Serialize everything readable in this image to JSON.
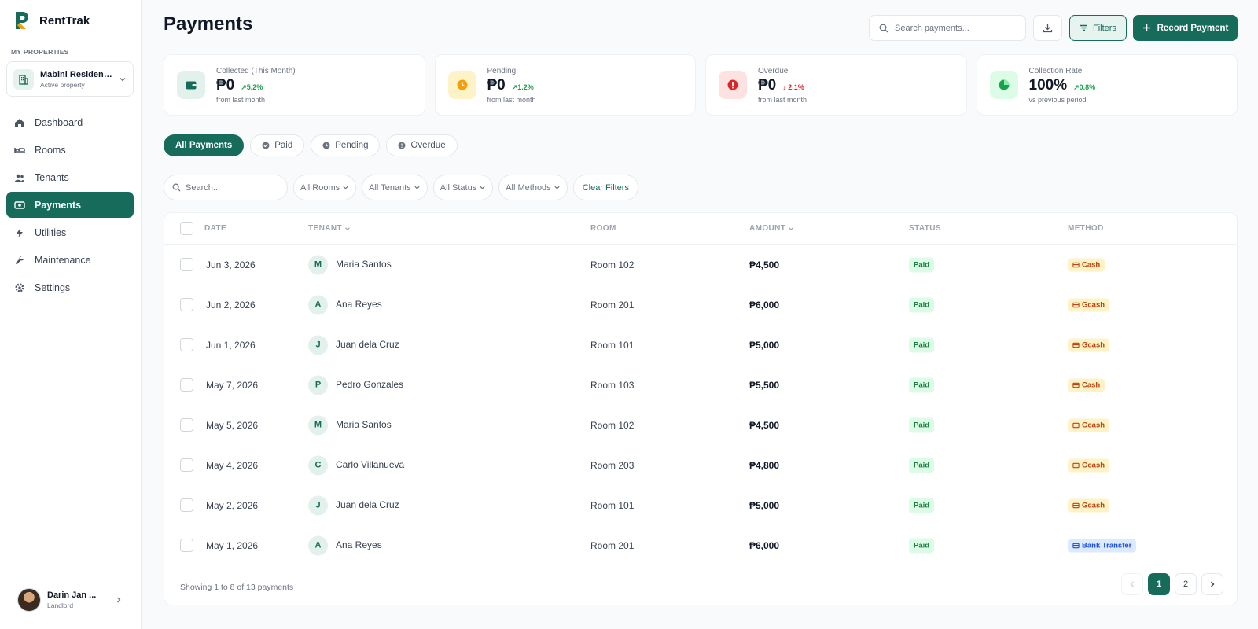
{
  "app": {
    "name": "RentTrak"
  },
  "sidebar": {
    "section_label": "MY PROPERTIES",
    "property": {
      "name": "Mabini Residenc...",
      "status": "Active property"
    },
    "items": [
      {
        "label": "Dashboard",
        "icon": "home-icon"
      },
      {
        "label": "Rooms",
        "icon": "bed-icon"
      },
      {
        "label": "Tenants",
        "icon": "users-icon"
      },
      {
        "label": "Payments",
        "icon": "money-icon",
        "active": true
      },
      {
        "label": "Utilities",
        "icon": "bolt-icon"
      },
      {
        "label": "Maintenance",
        "icon": "wrench-icon"
      },
      {
        "label": "Settings",
        "icon": "gear-icon"
      }
    ],
    "user": {
      "name": "Darin Jan ...",
      "role": "Landlord"
    }
  },
  "header": {
    "title": "Payments",
    "search_placeholder": "Search payments...",
    "filters_label": "Filters",
    "record_label": "Record Payment"
  },
  "stats": [
    {
      "label": "Collected (This Month)",
      "value": "₱0",
      "change": "5.2%",
      "direction": "up",
      "note": "from last month",
      "color": "#16a34a"
    },
    {
      "label": "Pending",
      "value": "₱0",
      "change": "1.2%",
      "direction": "up",
      "note": "from last month",
      "color": "#16a34a"
    },
    {
      "label": "Overdue",
      "value": "₱0",
      "change": "2.1%",
      "direction": "down",
      "note": "from last month",
      "color": "#dc2626"
    },
    {
      "label": "Collection Rate",
      "value": "100%",
      "change": "0.8%",
      "direction": "up",
      "note": "vs previous period",
      "color": "#16a34a"
    }
  ],
  "tabs": [
    {
      "label": "All Payments",
      "active": true
    },
    {
      "label": "Paid"
    },
    {
      "label": "Pending"
    },
    {
      "label": "Overdue"
    }
  ],
  "filters": {
    "search_placeholder": "Search...",
    "rooms": "All Rooms",
    "tenants": "All Tenants",
    "status": "All Status",
    "methods": "All Methods",
    "clear": "Clear Filters"
  },
  "table": {
    "columns": [
      "DATE",
      "TENANT",
      "ROOM",
      "AMOUNT",
      "STATUS",
      "METHOD"
    ],
    "rows": [
      {
        "date": "Jun 3, 2026",
        "initial": "M",
        "tenant": "Maria Santos",
        "room": "Room 102",
        "amount": "₱4,500",
        "status": "Paid",
        "method": "Cash",
        "method_type": "cash"
      },
      {
        "date": "Jun 2, 2026",
        "initial": "A",
        "tenant": "Ana Reyes",
        "room": "Room 201",
        "amount": "₱6,000",
        "status": "Paid",
        "method": "Gcash",
        "method_type": "gcash"
      },
      {
        "date": "Jun 1, 2026",
        "initial": "J",
        "tenant": "Juan dela Cruz",
        "room": "Room 101",
        "amount": "₱5,000",
        "status": "Paid",
        "method": "Gcash",
        "method_type": "gcash"
      },
      {
        "date": "May 7, 2026",
        "initial": "P",
        "tenant": "Pedro Gonzales",
        "room": "Room 103",
        "amount": "₱5,500",
        "status": "Paid",
        "method": "Cash",
        "method_type": "cash"
      },
      {
        "date": "May 5, 2026",
        "initial": "M",
        "tenant": "Maria Santos",
        "room": "Room 102",
        "amount": "₱4,500",
        "status": "Paid",
        "method": "Gcash",
        "method_type": "gcash"
      },
      {
        "date": "May 4, 2026",
        "initial": "C",
        "tenant": "Carlo Villanueva",
        "room": "Room 203",
        "amount": "₱4,800",
        "status": "Paid",
        "method": "Gcash",
        "method_type": "gcash"
      },
      {
        "date": "May 2, 2026",
        "initial": "J",
        "tenant": "Juan dela Cruz",
        "room": "Room 101",
        "amount": "₱5,000",
        "status": "Paid",
        "method": "Gcash",
        "method_type": "gcash"
      },
      {
        "date": "May 1, 2026",
        "initial": "A",
        "tenant": "Ana Reyes",
        "room": "Room 201",
        "amount": "₱6,000",
        "status": "Paid",
        "method": "Bank Transfer",
        "method_type": "bank"
      }
    ],
    "footer": "Showing 1 to 8 of 13 payments",
    "pages": [
      "1",
      "2"
    ]
  },
  "colors": {
    "accent": "#176b5b",
    "paid": "#15803d",
    "overdue": "#dc2626"
  }
}
